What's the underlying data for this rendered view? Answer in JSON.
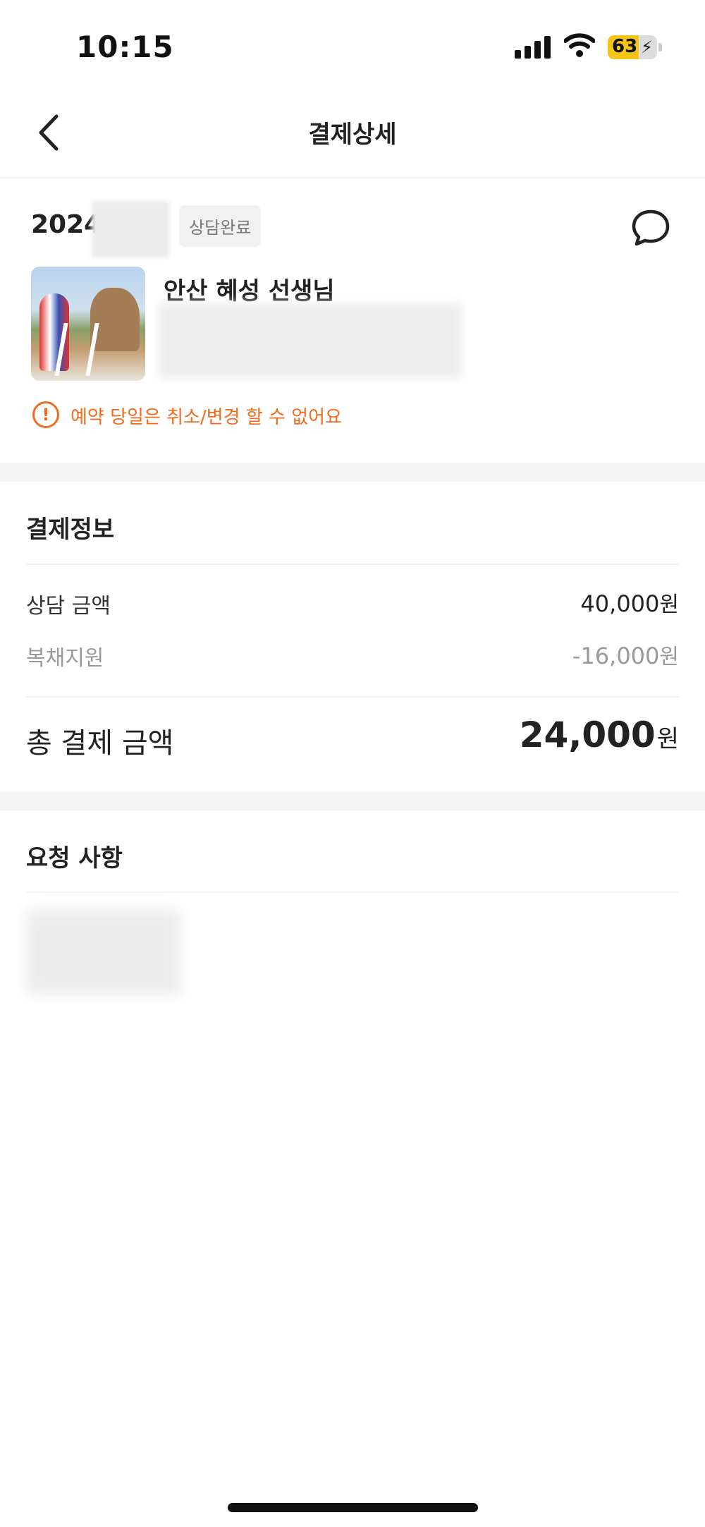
{
  "status_bar": {
    "time": "10:15",
    "battery_level": "63",
    "battery_fraction": 0.63,
    "battery_color": "#f5c518",
    "icons": [
      "cellular-signal-icon",
      "wifi-icon",
      "battery-charging-icon"
    ]
  },
  "header": {
    "title": "결제상세",
    "back_icon": "chevron-left-icon"
  },
  "reservation": {
    "date_prefix": "2024",
    "status_badge": "상담완료",
    "chat_icon": "chat-bubble-icon",
    "teacher_name": "안산 혜성 선생님",
    "notice_icon": "exclamation-circle-icon",
    "notice_text": "예약 당일은 취소/변경 할 수 없어요",
    "notice_color": "#f26b1d"
  },
  "payment": {
    "title": "결제정보",
    "rows": [
      {
        "label": "상담 금액",
        "amount": "40,000",
        "unit": "원"
      },
      {
        "label": "복채지원",
        "amount": "-16,000",
        "unit": "원"
      }
    ],
    "total_label": "총 결제 금액",
    "total_amount": "24,000",
    "total_unit": "원"
  },
  "request": {
    "title": "요청 사항"
  }
}
